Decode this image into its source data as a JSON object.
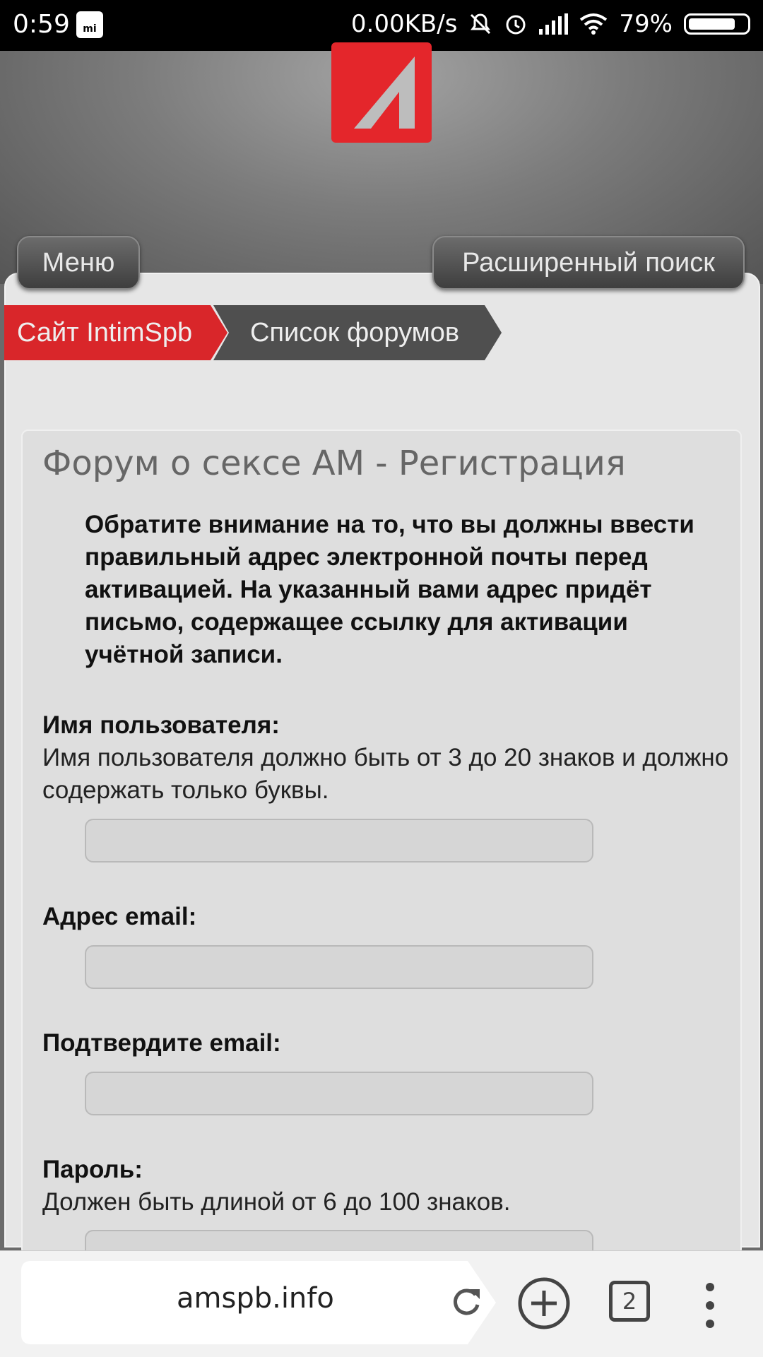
{
  "status_bar": {
    "time": "0:59",
    "mi_label": "mi",
    "network_speed": "0.00KB/s",
    "battery": "79%",
    "battery_level": 0.79,
    "icons": [
      "mute-icon",
      "alarm-icon",
      "signal-icon",
      "wifi-icon",
      "battery-icon"
    ]
  },
  "header": {
    "menu_label": "Меню",
    "advanced_search_label": "Расширенный поиск"
  },
  "breadcrumbs": [
    {
      "label": "Сайт IntimSpb"
    },
    {
      "label": "Список форумов"
    }
  ],
  "form": {
    "title": "Форум о сексе АМ - Регистрация",
    "notice": "Обратите внимание на то, что вы должны ввести правильный адрес электронной почты перед активацией. На указанный вами адрес придёт письмо, содержащее ссылку для активации учётной записи.",
    "username_label": "Имя пользователя:",
    "username_help": "Имя пользователя должно быть от 3 до 20 знаков и должно содержать только буквы.",
    "username_value": "",
    "email_label": "Адрес email:",
    "email_value": "",
    "confirm_email_label": "Подтвердите email:",
    "confirm_email_value": "",
    "password_label": "Пароль:",
    "password_help": "Должен быть длиной от 6 до 100 знаков.",
    "password_value": ""
  },
  "browser": {
    "url": "amspb.info",
    "tab_count": "2"
  },
  "colors": {
    "accent_red": "#e4262b",
    "status_bar": "#000000"
  }
}
